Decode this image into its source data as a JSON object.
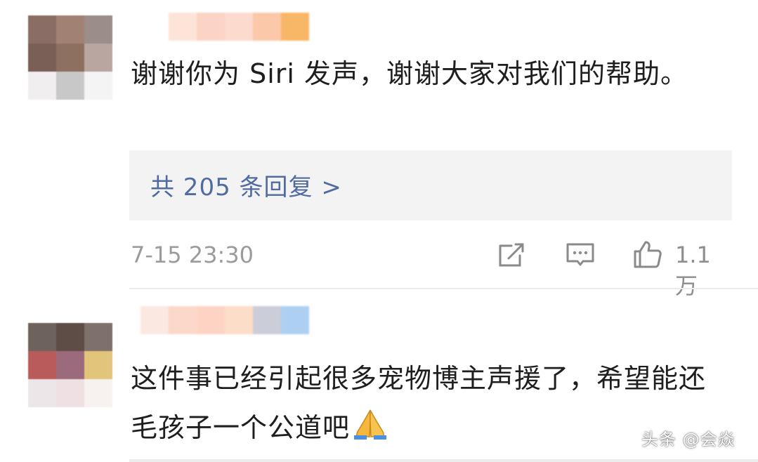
{
  "comments": [
    {
      "text": "谢谢你为 Siri 发声，谢谢大家对我们的帮助。",
      "reply_link": "共 205 条回复 >",
      "timestamp": "7-15 23:30",
      "like_count": "1.1万",
      "avatar_colors": [
        "#8a6e66",
        "#a18174",
        "#9b8d88",
        "#7a5f56",
        "#8d7060",
        "#b9a6a0",
        "#f1eef0",
        "#c8c8c8",
        "#f4f4f4"
      ],
      "username_colors": [
        "#ffffff",
        "#fde2d6",
        "#fbd2c2",
        "#fcd9cb",
        "#fbc6a6",
        "#f8b35f"
      ]
    },
    {
      "text": "这件事已经引起很多宠物博主声援了，希望能还毛孩子一个公道吧",
      "emoji": "praying-hands",
      "avatar_colors": [
        "#6d635c",
        "#5e4c47",
        "#7e706a",
        "#b95b5b",
        "#9b6b7d",
        "#e2c47a",
        "#ece6e8",
        "#efe0e4",
        "#f7f1ef"
      ],
      "username_colors": [
        "#fbe7e0",
        "#fbd6c8",
        "#fdd2c0",
        "#fcdcc6",
        "#c9cbd6",
        "#a9cdf2"
      ]
    }
  ],
  "icons": {
    "share": "share-icon",
    "comment": "comment-icon",
    "like": "thumbs-up-icon"
  },
  "watermark": "头条 @会焱",
  "colors": {
    "reply_link": "#506ba0",
    "timestamp": "#9b9b9b",
    "reply_box_bg": "#f3f3f3"
  }
}
